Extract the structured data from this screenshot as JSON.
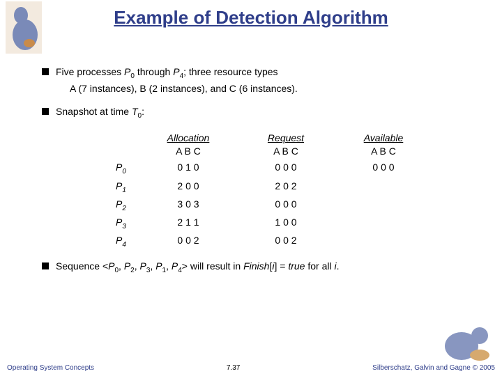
{
  "title": "Example of Detection Algorithm",
  "bullets": {
    "b1": {
      "line1_a": "Five processes ",
      "p0": "P",
      "p0_sub": "0",
      "line1_b": " through ",
      "p4": "P",
      "p4_sub": "4",
      "line1_c": "; three resource types",
      "line2": "A (7 instances), B (2 instances), and C (6 instances)."
    },
    "b2": {
      "line1_a": "Snapshot at time ",
      "t": "T",
      "t_sub": "0",
      "line1_b": ":"
    },
    "b3": {
      "a": "Sequence <",
      "s0": "P",
      "s0s": "0",
      "c0": ", ",
      "s1": "P",
      "s1s": "2",
      "c1": ", ",
      "s2": "P",
      "s2s": "3",
      "c2": ", ",
      "s3": "P",
      "s3s": "1",
      "c3": ", ",
      "s4": "P",
      "s4s": "4",
      "b": "> will result in ",
      "fin": "Finish",
      "br1": "[",
      "ii": "i",
      "br2": "] = ",
      "tr": "true",
      "end": " for all ",
      "ii2": "i",
      "dot": "."
    }
  },
  "table": {
    "headers": {
      "h1": "Allocation",
      "h2": "Request",
      "h3": "Available"
    },
    "sub": {
      "s1": "A B C",
      "s2": "A B C",
      "s3": "A B C"
    },
    "rows": [
      {
        "p": "P",
        "ps": "0",
        "alloc": "0 1 0",
        "req": "0 0 0",
        "avail": "0 0 0"
      },
      {
        "p": "P",
        "ps": "1",
        "alloc": "2 0 0",
        "req": "2 0 2",
        "avail": ""
      },
      {
        "p": "P",
        "ps": "2",
        "alloc": "3 0 3",
        "req": "0 0 0",
        "avail": ""
      },
      {
        "p": "P",
        "ps": "3",
        "alloc": "2 1 1",
        "req": "1 0 0",
        "avail": ""
      },
      {
        "p": "P",
        "ps": "4",
        "alloc": "0 0 2",
        "req": "0 0 2",
        "avail": ""
      }
    ]
  },
  "footer": {
    "left": "Operating System Concepts",
    "center": "7.37",
    "right_a": "Silberschatz, Galvin and Gagne ",
    "right_b": "© 2005"
  },
  "icons": {
    "dino": "dinosaur-mascot"
  }
}
